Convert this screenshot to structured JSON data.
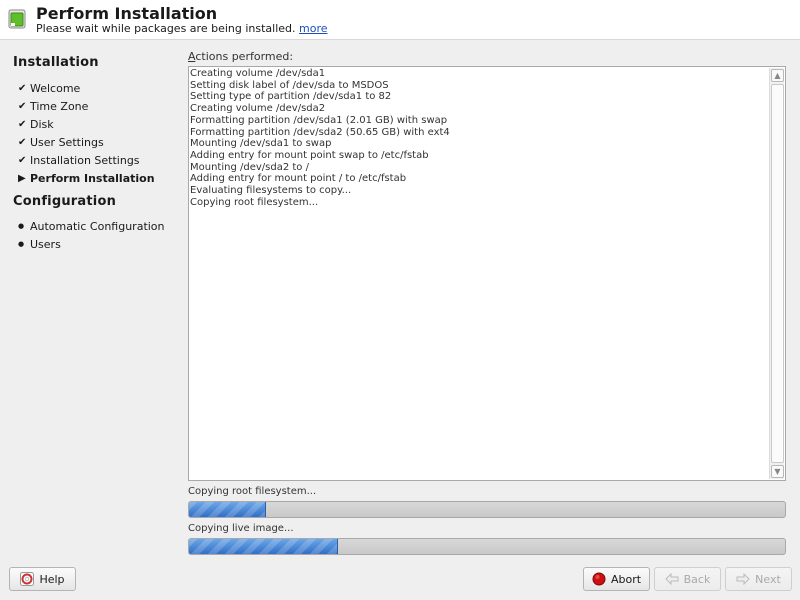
{
  "header": {
    "title": "Perform Installation",
    "subtitle": "Please wait while packages are being installed.",
    "more_link": "more"
  },
  "sidebar": {
    "sections": [
      {
        "title": "Installation",
        "items": [
          {
            "label": "Welcome",
            "state": "done"
          },
          {
            "label": "Time Zone",
            "state": "done"
          },
          {
            "label": "Disk",
            "state": "done"
          },
          {
            "label": "User Settings",
            "state": "done"
          },
          {
            "label": "Installation Settings",
            "state": "done"
          },
          {
            "label": "Perform Installation",
            "state": "current"
          }
        ]
      },
      {
        "title": "Configuration",
        "items": [
          {
            "label": "Automatic Configuration",
            "state": "pending"
          },
          {
            "label": "Users",
            "state": "pending"
          }
        ]
      }
    ],
    "marks": {
      "done": "✔",
      "current": "▶",
      "pending": "●"
    }
  },
  "actions": {
    "label_mnemonic": "A",
    "label_rest": "ctions performed:",
    "lines": [
      "Creating volume /dev/sda1",
      "Setting disk label of /dev/sda to MSDOS",
      "Setting type of partition /dev/sda1 to 82",
      "Creating volume /dev/sda2",
      "Formatting partition /dev/sda1 (2.01 GB) with swap",
      "Formatting partition /dev/sda2 (50.65 GB) with ext4",
      "Mounting /dev/sda1 to swap",
      "Adding entry for mount point swap to /etc/fstab",
      "Mounting /dev/sda2 to /",
      "Adding entry for mount point / to /etc/fstab",
      "Evaluating filesystems to copy...",
      "Copying root filesystem..."
    ]
  },
  "progress": [
    {
      "label": "Copying root filesystem...",
      "fraction": 0.13
    },
    {
      "label": "Copying live image...",
      "fraction": 0.25
    }
  ],
  "buttons": {
    "help": "Help",
    "abort": "Abort",
    "back": "Back",
    "next": "Next"
  },
  "icons": {
    "header": "installer-app-icon",
    "help": "lifebuoy-icon",
    "abort": "stop-red-icon",
    "back": "back-arrow-icon",
    "next": "next-arrow-icon"
  },
  "colors": {
    "progress_fill": "#3b7bd0",
    "abort_red": "#cc1111",
    "link": "#1d4ec0"
  }
}
